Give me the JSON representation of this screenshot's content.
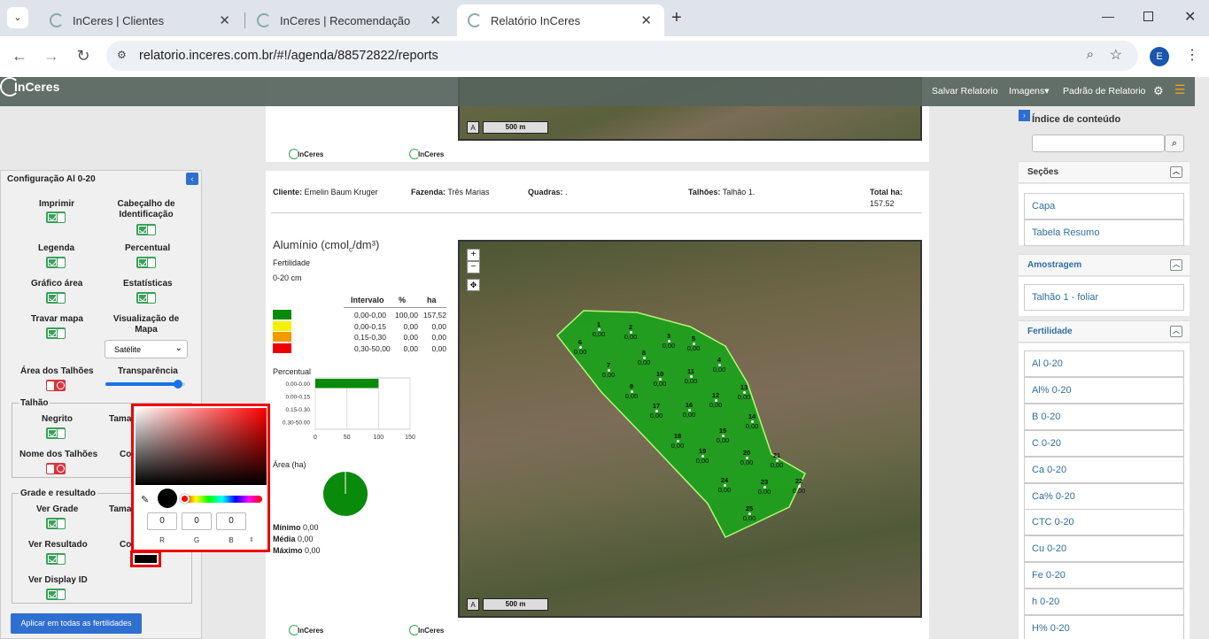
{
  "browser": {
    "tabs": [
      {
        "title": "InCeres | Clientes",
        "active": false
      },
      {
        "title": "InCeres | Recomendação",
        "active": false
      },
      {
        "title": "Relatório InCeres",
        "active": true
      }
    ],
    "new_tab": "+",
    "url": "relatorio.inceres.com.br/#!/agenda/88572822/reports",
    "profile_initial": "E"
  },
  "appbar": {
    "logo": "InCeres",
    "menu": [
      "Salvar Relatorio",
      "Imagens",
      "Padrão de Relatorio"
    ]
  },
  "report": {
    "brand": "InCeres",
    "scale_label": "500 m",
    "scale_arrow": "A",
    "cliente_label": "Cliente:",
    "cliente": "Emelin Baum Kruger",
    "fazenda_label": "Fazenda:",
    "fazenda": "Três Marias",
    "quadras_label": "Quadras:",
    "quadras": ".",
    "talhoes_label": "Talhões:",
    "talhoes": "Talhão 1.",
    "total_label": "Total ha:",
    "total": "157.52",
    "title": "Alumínio (cmol",
    "title_sub": "c",
    "title_end": "/dm³)",
    "subtitle1": "Fertilidade",
    "subtitle2": "0-20 cm",
    "legend_headers": [
      "Intervalo",
      "%",
      "ha"
    ],
    "legend_rows": [
      {
        "color": "#0a8a0a",
        "interval": "0,00-0,00",
        "pct": "100,00",
        "ha": "157,52"
      },
      {
        "color": "#f2f200",
        "interval": "0,00-0,15",
        "pct": "0,00",
        "ha": "0,00"
      },
      {
        "color": "#f29a00",
        "interval": "0,15-0,30",
        "pct": "0,00",
        "ha": "0,00"
      },
      {
        "color": "#ee0000",
        "interval": "0,30-50,00",
        "pct": "0,00",
        "ha": "0,00"
      }
    ],
    "percentual_label": "Percentual",
    "area_label": "Área (ha)",
    "minimo_label": "Mínimo",
    "minimo": "0,00",
    "media_label": "Média",
    "media": "0,00",
    "maximo_label": "Máximo",
    "maximo": "0,00",
    "zoom_in": "+",
    "zoom_out": "−",
    "samples": [
      {
        "n": "1",
        "v": "0,00"
      },
      {
        "n": "2",
        "v": "0,00"
      },
      {
        "n": "3",
        "v": "0,00"
      },
      {
        "n": "5",
        "v": "0,00"
      },
      {
        "n": "6",
        "v": "0,00"
      },
      {
        "n": "7",
        "v": "0,00"
      },
      {
        "n": "8",
        "v": "0,00"
      },
      {
        "n": "4",
        "v": "0,00"
      },
      {
        "n": "10",
        "v": "0,00"
      },
      {
        "n": "11",
        "v": "0,00"
      },
      {
        "n": "9",
        "v": "0,00"
      },
      {
        "n": "12",
        "v": "0,00"
      },
      {
        "n": "13",
        "v": "0,00"
      },
      {
        "n": "17",
        "v": "0,00"
      },
      {
        "n": "16",
        "v": "0,00"
      },
      {
        "n": "14",
        "v": "0,00"
      },
      {
        "n": "15",
        "v": "0,00"
      },
      {
        "n": "18",
        "v": "0,00"
      },
      {
        "n": "19",
        "v": "0,00"
      },
      {
        "n": "20",
        "v": "0,00"
      },
      {
        "n": "21",
        "v": "0,00"
      },
      {
        "n": "24",
        "v": "0,00"
      },
      {
        "n": "23",
        "v": "0,00"
      },
      {
        "n": "22",
        "v": "0,00"
      },
      {
        "n": "25",
        "v": "0,00"
      }
    ]
  },
  "chart_data": {
    "type": "bar",
    "categories": [
      "0.00-0.00",
      "0.00-0.15",
      "0.15-0.30",
      "0.30-50.00"
    ],
    "values": [
      100,
      0,
      0,
      0
    ],
    "xlim": [
      0,
      150
    ],
    "xticks": [
      "0",
      "50",
      "100",
      "150"
    ],
    "color": "#0a8a0a",
    "pie": {
      "values": [
        100
      ],
      "color": "#0a8a0a"
    }
  },
  "config": {
    "title": "Configuração Al 0-20",
    "imprimir": "Imprimir",
    "cabecalho": "Cabeçalho de Identificação",
    "legenda": "Legenda",
    "percentual": "Percentual",
    "grafico_area": "Gráfico área",
    "estatisticas": "Estatísticas",
    "travar_mapa": "Travar mapa",
    "visualizacao": "Visualização de Mapa",
    "map_type": "Satélite",
    "area_talhoes": "Área dos Talhões",
    "transparencia": "Transparência",
    "transparencia_value": 0.93,
    "talhao": "Talhão",
    "negrito": "Negrito",
    "tamanho": "Tama",
    "nome_talhoes": "Nome dos Talhões",
    "cor": "Co",
    "grade_resultado": "Grade e resultado",
    "ver_grade": "Ver Grade",
    "ver_resultado": "Ver Resultado",
    "ver_display": "Ver Display ID",
    "apply_button": "Aplicar em todas as fertilidades"
  },
  "picker": {
    "r": "0",
    "g": "0",
    "b": "0",
    "r_label": "R",
    "g_label": "G",
    "b_label": "B",
    "color": "#000000"
  },
  "index": {
    "title": "Índice de conteúdo",
    "search_placeholder": "",
    "secoes": "Seções",
    "secoes_items": [
      "Capa",
      "Tabela Resumo"
    ],
    "amostragem": "Amostragem",
    "amostragem_items": [
      "Talhão 1 - foliar"
    ],
    "fertilidade": "Fertilidade",
    "fertilidade_items": [
      "Al 0-20",
      "Al% 0-20",
      "B 0-20",
      "C 0-20",
      "Ca 0-20",
      "Ca% 0-20",
      "CTC 0-20",
      "Cu 0-20",
      "Fe 0-20",
      "h 0-20",
      "H% 0-20"
    ]
  }
}
